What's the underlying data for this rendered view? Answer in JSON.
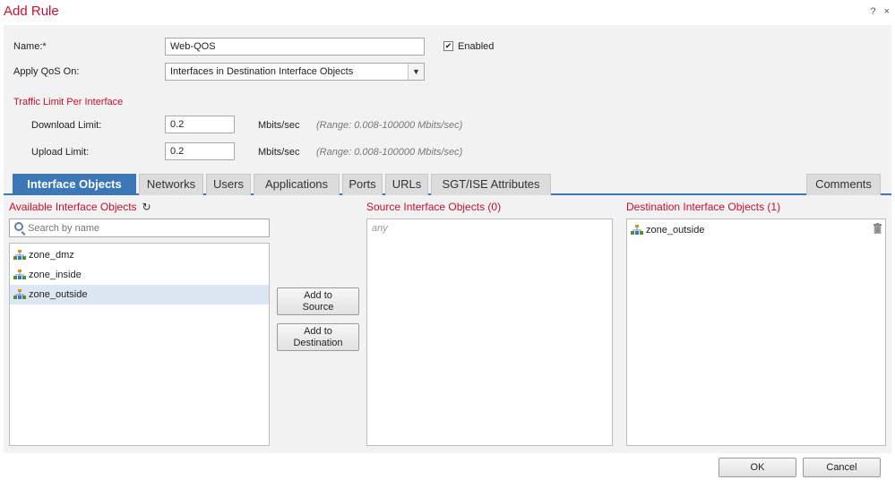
{
  "dialog": {
    "title": "Add Rule",
    "help": "?",
    "close": "×"
  },
  "form": {
    "name_label": "Name:*",
    "name_value": "Web-QOS",
    "enabled_label": "Enabled",
    "enabled_checked": "✔",
    "apply_label": "Apply QoS On:",
    "apply_value": "Interfaces in Destination Interface Objects",
    "traffic_title": "Traffic Limit Per Interface",
    "download_label": "Download Limit:",
    "download_value": "0.2",
    "download_unit": "Mbits/sec",
    "download_range": "(Range: 0.008-100000 Mbits/sec)",
    "upload_label": "Upload Limit:",
    "upload_value": "0.2",
    "upload_unit": "Mbits/sec",
    "upload_range": "(Range: 0.008-100000 Mbits/sec)"
  },
  "tabs": [
    {
      "label": "Interface Objects",
      "active": true
    },
    {
      "label": "Networks"
    },
    {
      "label": "Users"
    },
    {
      "label": "Applications"
    },
    {
      "label": "Ports"
    },
    {
      "label": "URLs"
    },
    {
      "label": "SGT/ISE Attributes"
    },
    {
      "label": "Comments"
    }
  ],
  "available": {
    "title": "Available Interface Objects",
    "refresh_glyph": "↻",
    "search_placeholder": "Search by name",
    "items": [
      {
        "label": "zone_dmz"
      },
      {
        "label": "zone_inside"
      },
      {
        "label": "zone_outside",
        "selected": true
      }
    ]
  },
  "buttons": {
    "add_source_line1": "Add to",
    "add_source_line2": "Source",
    "add_dest_line1": "Add to",
    "add_dest_line2": "Destination"
  },
  "source": {
    "title": "Source Interface Objects (0)",
    "placeholder": "any"
  },
  "destination": {
    "title": "Destination Interface Objects (1)",
    "items": [
      {
        "label": "zone_outside"
      }
    ]
  },
  "footer": {
    "ok": "OK",
    "cancel": "Cancel"
  },
  "colors": {
    "accent_red": "#c8102e",
    "tab_active": "#3c78b5",
    "panel_bg": "#f2f2f2"
  }
}
